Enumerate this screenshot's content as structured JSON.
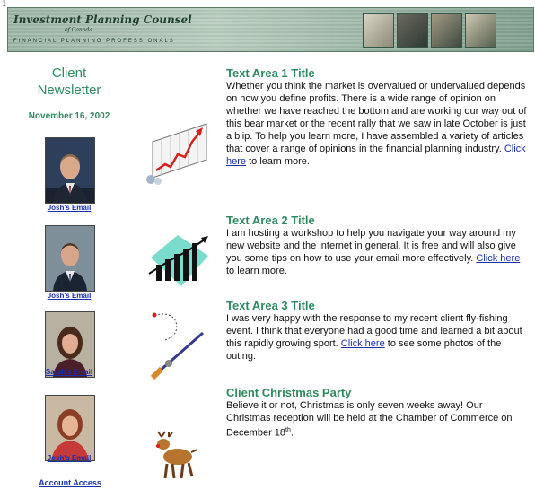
{
  "page_mark": "1",
  "header": {
    "org_name": "Investment Planning Counsel",
    "org_sub": "of Canada",
    "tagline": "FINANCIAL PLANNING PROFESSIONALS"
  },
  "sidebar": {
    "heading_line1": "Client",
    "heading_line2": "Newsletter",
    "date": "November 16, 2002",
    "people": [
      {
        "link": "Josh's Email"
      },
      {
        "link": "Josh's Email"
      },
      {
        "link": "Sarah's Email"
      },
      {
        "link": "Josh's Email"
      }
    ],
    "account_link": "Account Access"
  },
  "sections": [
    {
      "title": "Text Area 1 Title",
      "body_before": "Whether you think the market is overvalued or undervalued depends on how you define profits. There is a wide range of opinion on whether we have reached the bottom and are working our way out of this bear market or the recent rally that we saw in late October is just a blip. To help you learn more, I have assembled a variety of articles that cover a range of opinions in the financial planning industry.",
      "link": "Click here",
      "body_after": " to learn more."
    },
    {
      "title": "Text Area 2 Title",
      "body_before": "I am hosting a workshop to help you navigate your way around my new website and the internet in general. It is free and will also give you some tips on how to use your email more effectively.",
      "link": "Click here",
      "body_after": " to learn more."
    },
    {
      "title": "Text Area 3 Title",
      "body_before": "I was very happy with the response to my recent client fly-fishing event. I think that everyone had a good time and learned a bit about this rapidly growing sport.",
      "link": "Click here",
      "body_after": " to see some photos of the outing."
    },
    {
      "title": "Client Christmas Party",
      "body_before": "Believe it or not, Christmas is only seven weeks away! Our Christmas reception will be held at the Chamber of Commerce on December 18",
      "sup": "th",
      "body_after": "."
    }
  ],
  "colors": {
    "accent_green": "#2f8a61",
    "link_blue": "#1a2fae",
    "banner_green": "#9db6a7"
  },
  "icons": [
    "rising-chart-clipart-icon",
    "growth-chart-clipart-icon",
    "fishing-rod-clipart-icon",
    "reindeer-clipart-icon"
  ]
}
